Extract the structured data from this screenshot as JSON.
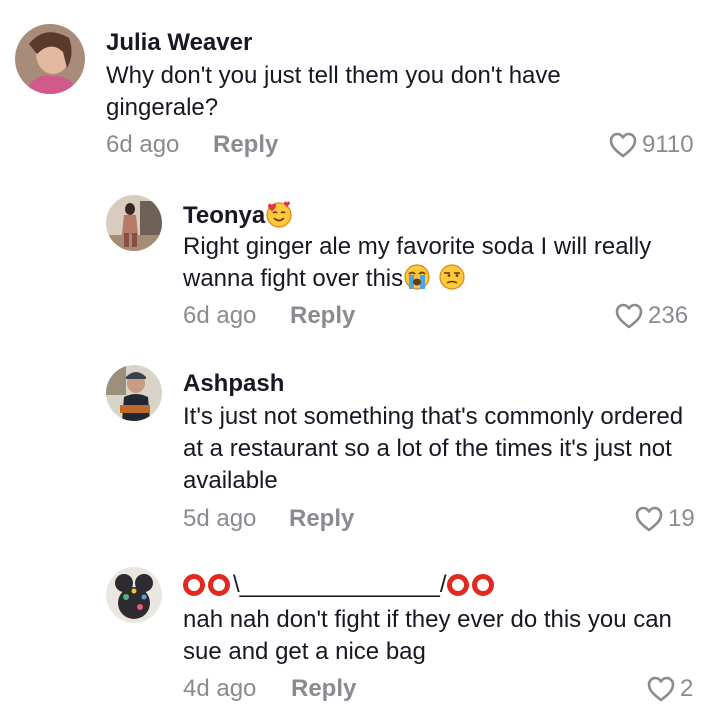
{
  "comments": [
    {
      "username": "Julia Weaver",
      "text": "Why don't you just tell them you don't have gingerale?",
      "time": "6d ago",
      "reply": "Reply",
      "likes": "9110"
    },
    {
      "username": "Teonya",
      "text": "Right ginger ale my favorite soda I will really wanna fight over this",
      "time": "6d ago",
      "reply": "Reply",
      "likes": "236"
    },
    {
      "username": "Ashpash",
      "text": "It's just not something that's commonly ordered at a restaurant so a lot of the times it's just not available",
      "time": "5d ago",
      "reply": "Reply",
      "likes": "19"
    },
    {
      "username_middle": "\\_______________/",
      "text": "nah nah don't fight if they ever do this you can sue and get a nice bag",
      "time": "4d ago",
      "reply": "Reply",
      "likes": "2"
    }
  ],
  "colors": {
    "text": "#161823",
    "muted": "#8a8b91",
    "red": "#e0291f"
  }
}
